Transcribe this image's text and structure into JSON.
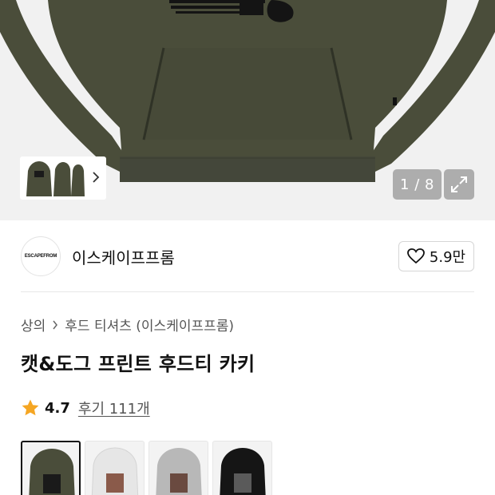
{
  "gallery": {
    "counter": "1 / 8",
    "colors": {
      "background": "#f1f1f1",
      "hoodie": "#4a4d3a",
      "print": "#141414"
    }
  },
  "brand": {
    "logo_text": "ESCAPEFROM",
    "name": "이스케이프프롬",
    "likes": "5.9만"
  },
  "breadcrumb": {
    "category": "상의",
    "subcategory": "후드 티셔츠 (이스케이프프롬)"
  },
  "product": {
    "title": "캣&도그 프린트 후드티 카키"
  },
  "rating": {
    "value": "4.7",
    "reviews_label": "후기 111개",
    "star_color": "#f5a623"
  },
  "variants": [
    {
      "name": "khaki",
      "color": "#4a4d3a",
      "selected": true
    },
    {
      "name": "white",
      "color": "#f0f0f0",
      "selected": false
    },
    {
      "name": "gray",
      "color": "#bdbdbd",
      "selected": false
    },
    {
      "name": "black",
      "color": "#151515",
      "selected": false
    }
  ]
}
